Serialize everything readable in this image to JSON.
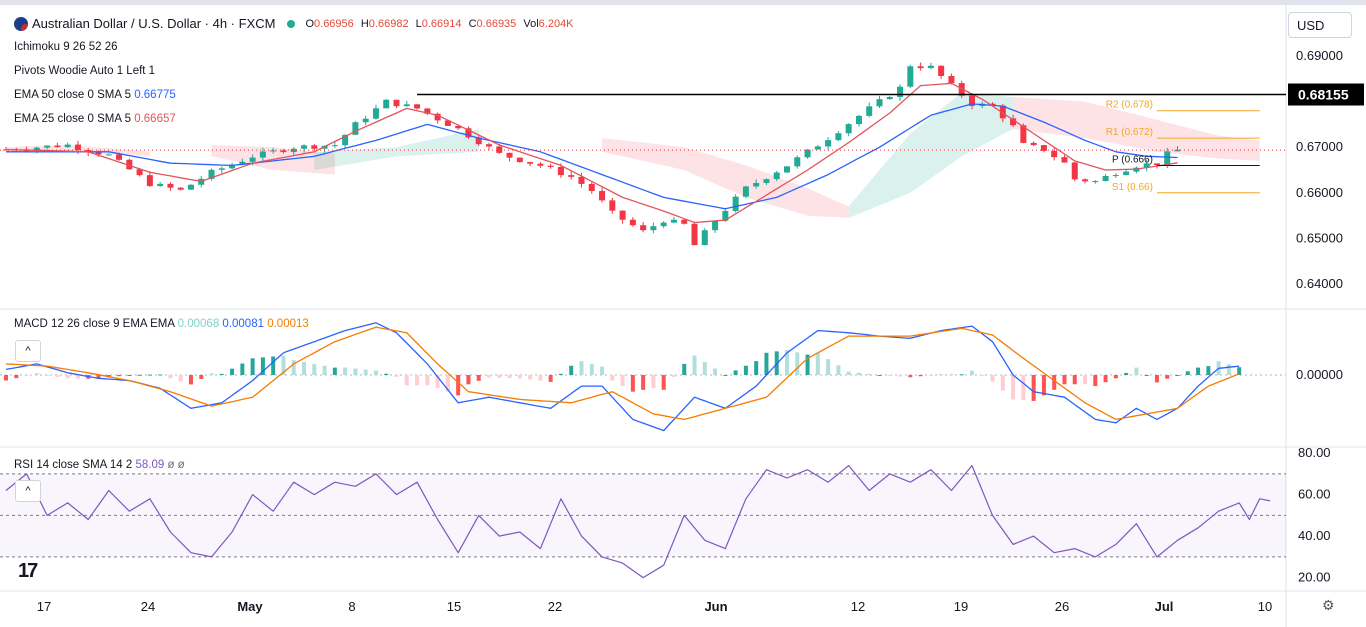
{
  "header": {
    "symbol_title": "Australian Dollar / U.S. Dollar · 4h · FXCM",
    "open_label": "O",
    "open": "0.66956",
    "high_label": "H",
    "high": "0.66982",
    "low_label": "L",
    "low": "0.66914",
    "close_label": "C",
    "close": "0.66935",
    "vol_label": "Vol",
    "vol": "6.204K",
    "market_status_color": "#22ab94"
  },
  "indicators": {
    "ichimoku": "Ichimoku 9 26 52 26",
    "pivots": "Pivots Woodie Auto 1 Left 1",
    "ema50_label": "EMA 50 close 0 SMA 5",
    "ema50_value": "0.66775",
    "ema25_label": "EMA 25 close 0 SMA 5",
    "ema25_value": "0.66657",
    "macd_label": "MACD 12 26 close 9 EMA EMA",
    "macd_hist": "0.00068",
    "macd_line": "0.00081",
    "macd_signal": "0.00013",
    "rsi_label": "RSI 14 close SMA 14 2",
    "rsi_value": "58.09",
    "rsi_extra": "ø ø"
  },
  "currency_button": "USD",
  "collapse_icon_glyph": "^",
  "tv_logo_text": "17",
  "colors": {
    "up": "#22ab94",
    "down": "#f23645",
    "ema50": "#2962ff",
    "ema25": "#e0555f",
    "signal": "#f57c00",
    "rsi": "#7e57c2",
    "pivot": "#f5a623"
  },
  "chart_data": [
    {
      "type": "candlestick",
      "title": "Australian Dollar / U.S. Dollar · 4h · FXCM",
      "x_ticks": [
        "17",
        "24",
        "May",
        "8",
        "15",
        "22",
        "Jun",
        "12",
        "19",
        "26",
        "Jul",
        "10"
      ],
      "ylim": [
        0.6365,
        0.6935
      ],
      "y_ticks": [
        "0.69000",
        "0.68000",
        "0.67000",
        "0.66000",
        "0.65000",
        "0.64000"
      ],
      "last_price_line": "0.66935",
      "resistance_label": "0.68155",
      "resistance_value": 0.68155,
      "pivots": [
        {
          "name": "R2 (0.678)",
          "value": 0.678
        },
        {
          "name": "R1 (0.672)",
          "value": 0.672
        },
        {
          "name": "P (0.666)",
          "value": 0.666
        },
        {
          "name": "S1 (0.66)",
          "value": 0.66
        }
      ],
      "close_path": [
        [
          0,
          0.6695
        ],
        [
          6,
          0.6705
        ],
        [
          10,
          0.6682
        ],
        [
          14,
          0.662
        ],
        [
          17,
          0.6605
        ],
        [
          20,
          0.6645
        ],
        [
          24,
          0.668
        ],
        [
          28,
          0.67
        ],
        [
          32,
          0.6705
        ],
        [
          34,
          0.675
        ],
        [
          37,
          0.68
        ],
        [
          40,
          0.6785
        ],
        [
          42,
          0.6762
        ],
        [
          44,
          0.674
        ],
        [
          48,
          0.6685
        ],
        [
          52,
          0.666
        ],
        [
          55,
          0.6635
        ],
        [
          57,
          0.6605
        ],
        [
          59,
          0.6555
        ],
        [
          62,
          0.6515
        ],
        [
          64,
          0.654
        ],
        [
          66,
          0.653
        ],
        [
          67,
          0.6485
        ],
        [
          69,
          0.654
        ],
        [
          72,
          0.661
        ],
        [
          76,
          0.666
        ],
        [
          80,
          0.672
        ],
        [
          84,
          0.6785
        ],
        [
          87,
          0.683
        ],
        [
          88,
          0.688
        ],
        [
          90,
          0.6875
        ],
        [
          92,
          0.6835
        ],
        [
          94,
          0.6795
        ],
        [
          96,
          0.679
        ],
        [
          98,
          0.6745
        ],
        [
          99,
          0.6705
        ],
        [
          101,
          0.6695
        ],
        [
          103,
          0.6665
        ],
        [
          104,
          0.663
        ],
        [
          106,
          0.6625
        ],
        [
          108,
          0.6645
        ],
        [
          110,
          0.666
        ],
        [
          112,
          0.6665
        ],
        [
          113,
          0.6685
        ],
        [
          114,
          0.66935
        ]
      ],
      "ema25_path": [
        [
          0,
          0.6695
        ],
        [
          8,
          0.669
        ],
        [
          14,
          0.6645
        ],
        [
          19,
          0.6625
        ],
        [
          24,
          0.6665
        ],
        [
          30,
          0.669
        ],
        [
          34,
          0.6735
        ],
        [
          39,
          0.6785
        ],
        [
          42,
          0.677
        ],
        [
          48,
          0.6705
        ],
        [
          54,
          0.666
        ],
        [
          60,
          0.659
        ],
        [
          64,
          0.656
        ],
        [
          67,
          0.6535
        ],
        [
          70,
          0.654
        ],
        [
          74,
          0.6595
        ],
        [
          78,
          0.665
        ],
        [
          82,
          0.671
        ],
        [
          86,
          0.6775
        ],
        [
          89,
          0.6835
        ],
        [
          92,
          0.684
        ],
        [
          95,
          0.6805
        ],
        [
          98,
          0.676
        ],
        [
          101,
          0.6715
        ],
        [
          104,
          0.667
        ],
        [
          107,
          0.665
        ],
        [
          110,
          0.6652
        ],
        [
          113,
          0.6662
        ],
        [
          114,
          0.66657
        ]
      ],
      "ema50_path": [
        [
          0,
          0.669
        ],
        [
          10,
          0.669
        ],
        [
          16,
          0.6665
        ],
        [
          22,
          0.666
        ],
        [
          30,
          0.668
        ],
        [
          36,
          0.6715
        ],
        [
          41,
          0.675
        ],
        [
          46,
          0.672
        ],
        [
          52,
          0.669
        ],
        [
          58,
          0.664
        ],
        [
          64,
          0.659
        ],
        [
          70,
          0.6565
        ],
        [
          75,
          0.659
        ],
        [
          80,
          0.664
        ],
        [
          85,
          0.67
        ],
        [
          90,
          0.677
        ],
        [
          94,
          0.6795
        ],
        [
          97,
          0.679
        ],
        [
          101,
          0.6755
        ],
        [
          105,
          0.6715
        ],
        [
          108,
          0.669
        ],
        [
          111,
          0.668
        ],
        [
          114,
          0.66775
        ]
      ],
      "cloud_bands": [
        {
          "color": "red",
          "from": 0,
          "to": 14,
          "top_path": [
            [
              0,
              0.67
            ],
            [
              6,
              0.6705
            ],
            [
              14,
              0.669
            ]
          ],
          "bot_path": [
            [
              0,
              0.669
            ],
            [
              6,
              0.669
            ],
            [
              14,
              0.668
            ]
          ]
        },
        {
          "color": "red",
          "from": 20,
          "to": 32,
          "top_path": [
            [
              20,
              0.6705
            ],
            [
              26,
              0.67
            ],
            [
              32,
              0.6685
            ]
          ],
          "bot_path": [
            [
              20,
              0.668
            ],
            [
              26,
              0.665
            ],
            [
              32,
              0.664
            ]
          ]
        },
        {
          "color": "green",
          "from": 30,
          "to": 46,
          "top_path": [
            [
              30,
              0.669
            ],
            [
              38,
              0.67
            ],
            [
              46,
              0.674
            ]
          ],
          "bot_path": [
            [
              30,
              0.665
            ],
            [
              38,
              0.668
            ],
            [
              46,
              0.669
            ]
          ]
        },
        {
          "color": "red",
          "from": 58,
          "to": 82,
          "top_path": [
            [
              58,
              0.672
            ],
            [
              66,
              0.67
            ],
            [
              72,
              0.666
            ],
            [
              78,
              0.661
            ],
            [
              82,
              0.657
            ]
          ],
          "bot_path": [
            [
              58,
              0.669
            ],
            [
              66,
              0.665
            ],
            [
              72,
              0.659
            ],
            [
              78,
              0.655
            ],
            [
              82,
              0.6545
            ]
          ]
        },
        {
          "color": "green",
          "from": 82,
          "to": 98,
          "top_path": [
            [
              82,
              0.657
            ],
            [
              88,
              0.673
            ],
            [
              93,
              0.682
            ],
            [
              98,
              0.681
            ]
          ],
          "bot_path": [
            [
              82,
              0.6545
            ],
            [
              88,
              0.66
            ],
            [
              93,
              0.668
            ],
            [
              98,
              0.674
            ]
          ]
        },
        {
          "color": "red",
          "from": 98,
          "to": 122,
          "top_path": [
            [
              98,
              0.681
            ],
            [
              105,
              0.68
            ],
            [
              112,
              0.676
            ],
            [
              118,
              0.6725
            ],
            [
              122,
              0.6715
            ]
          ],
          "bot_path": [
            [
              98,
              0.674
            ],
            [
              105,
              0.672
            ],
            [
              112,
              0.669
            ],
            [
              118,
              0.6675
            ],
            [
              122,
              0.667
            ]
          ]
        }
      ]
    },
    {
      "type": "macd",
      "title": "MACD 12 26 close 9 EMA EMA",
      "ylim": [
        -0.0063,
        0.0054
      ],
      "y_ticks": [
        "0.00000"
      ],
      "macd_path": [
        [
          0,
          0.0005
        ],
        [
          3,
          0.001
        ],
        [
          6,
          0.0002
        ],
        [
          9,
          -0.0003
        ],
        [
          12,
          -0.0005
        ],
        [
          15,
          -0.0012
        ],
        [
          18,
          -0.003
        ],
        [
          21,
          -0.0025
        ],
        [
          24,
          -0.0005
        ],
        [
          27,
          0.002
        ],
        [
          30,
          0.003
        ],
        [
          33,
          0.004
        ],
        [
          36,
          0.0047
        ],
        [
          38,
          0.0038
        ],
        [
          41,
          0.001
        ],
        [
          44,
          -0.0025
        ],
        [
          47,
          -0.002
        ],
        [
          50,
          -0.0025
        ],
        [
          53,
          -0.003
        ],
        [
          56,
          -0.001
        ],
        [
          58,
          -0.001
        ],
        [
          61,
          -0.004
        ],
        [
          64,
          -0.005
        ],
        [
          67,
          -0.002
        ],
        [
          70,
          -0.003
        ],
        [
          73,
          -0.001
        ],
        [
          76,
          0.002
        ],
        [
          79,
          0.004
        ],
        [
          82,
          0.0038
        ],
        [
          85,
          0.0035
        ],
        [
          88,
          0.0033
        ],
        [
          91,
          0.004
        ],
        [
          94,
          0.0044
        ],
        [
          96,
          0.003
        ],
        [
          98,
          0.0
        ],
        [
          100,
          -0.0015
        ],
        [
          103,
          -0.002
        ],
        [
          106,
          -0.004
        ],
        [
          108,
          -0.0043
        ],
        [
          110,
          -0.003
        ],
        [
          112,
          -0.004
        ],
        [
          114,
          -0.003
        ],
        [
          116,
          -0.001
        ],
        [
          118,
          0.0006
        ],
        [
          120,
          0.0008
        ]
      ],
      "signal_path": [
        [
          0,
          0.001
        ],
        [
          4,
          0.0008
        ],
        [
          8,
          0.0002
        ],
        [
          12,
          -0.0005
        ],
        [
          16,
          -0.0015
        ],
        [
          20,
          -0.0028
        ],
        [
          24,
          -0.002
        ],
        [
          28,
          0.001
        ],
        [
          32,
          0.003
        ],
        [
          36,
          0.0043
        ],
        [
          39,
          0.0038
        ],
        [
          42,
          0.001
        ],
        [
          45,
          -0.0015
        ],
        [
          50,
          -0.0022
        ],
        [
          55,
          -0.0025
        ],
        [
          59,
          -0.0015
        ],
        [
          63,
          -0.0035
        ],
        [
          66,
          -0.004
        ],
        [
          70,
          -0.003
        ],
        [
          74,
          -0.002
        ],
        [
          78,
          0.0015
        ],
        [
          82,
          0.0035
        ],
        [
          88,
          0.0035
        ],
        [
          93,
          0.0042
        ],
        [
          96,
          0.0036
        ],
        [
          99,
          0.0015
        ],
        [
          102,
          -0.0005
        ],
        [
          105,
          -0.0025
        ],
        [
          108,
          -0.004
        ],
        [
          111,
          -0.0035
        ],
        [
          114,
          -0.003
        ],
        [
          117,
          -0.001
        ],
        [
          120,
          0.0001
        ]
      ]
    },
    {
      "type": "rsi",
      "title": "RSI 14 close SMA 14 2",
      "ylim": [
        15,
        82
      ],
      "y_ticks": [
        "80.00",
        "60.00",
        "40.00",
        "20.00"
      ],
      "band_levels": [
        70,
        50,
        30
      ],
      "rsi_path": [
        [
          0,
          62
        ],
        [
          2,
          70
        ],
        [
          4,
          50
        ],
        [
          6,
          56
        ],
        [
          8,
          48
        ],
        [
          10,
          62
        ],
        [
          12,
          52
        ],
        [
          14,
          58
        ],
        [
          16,
          42
        ],
        [
          18,
          32
        ],
        [
          20,
          30
        ],
        [
          22,
          42
        ],
        [
          24,
          60
        ],
        [
          26,
          52
        ],
        [
          28,
          66
        ],
        [
          30,
          60
        ],
        [
          32,
          66
        ],
        [
          34,
          64
        ],
        [
          36,
          70
        ],
        [
          38,
          60
        ],
        [
          40,
          66
        ],
        [
          42,
          48
        ],
        [
          44,
          32
        ],
        [
          46,
          50
        ],
        [
          48,
          40
        ],
        [
          50,
          42
        ],
        [
          52,
          34
        ],
        [
          54,
          58
        ],
        [
          56,
          40
        ],
        [
          58,
          30
        ],
        [
          60,
          27
        ],
        [
          62,
          20
        ],
        [
          64,
          26
        ],
        [
          66,
          50
        ],
        [
          68,
          38
        ],
        [
          70,
          34
        ],
        [
          72,
          58
        ],
        [
          74,
          72
        ],
        [
          76,
          68
        ],
        [
          78,
          72
        ],
        [
          80,
          66
        ],
        [
          82,
          74
        ],
        [
          84,
          62
        ],
        [
          86,
          70
        ],
        [
          88,
          66
        ],
        [
          90,
          72
        ],
        [
          92,
          62
        ],
        [
          94,
          74
        ],
        [
          96,
          50
        ],
        [
          98,
          36
        ],
        [
          100,
          40
        ],
        [
          102,
          32
        ],
        [
          104,
          34
        ],
        [
          106,
          30
        ],
        [
          108,
          36
        ],
        [
          110,
          46
        ],
        [
          112,
          30
        ],
        [
          114,
          38
        ],
        [
          116,
          44
        ],
        [
          118,
          52
        ],
        [
          120,
          56
        ],
        [
          121,
          48
        ],
        [
          122,
          58
        ],
        [
          123,
          57
        ]
      ]
    }
  ]
}
